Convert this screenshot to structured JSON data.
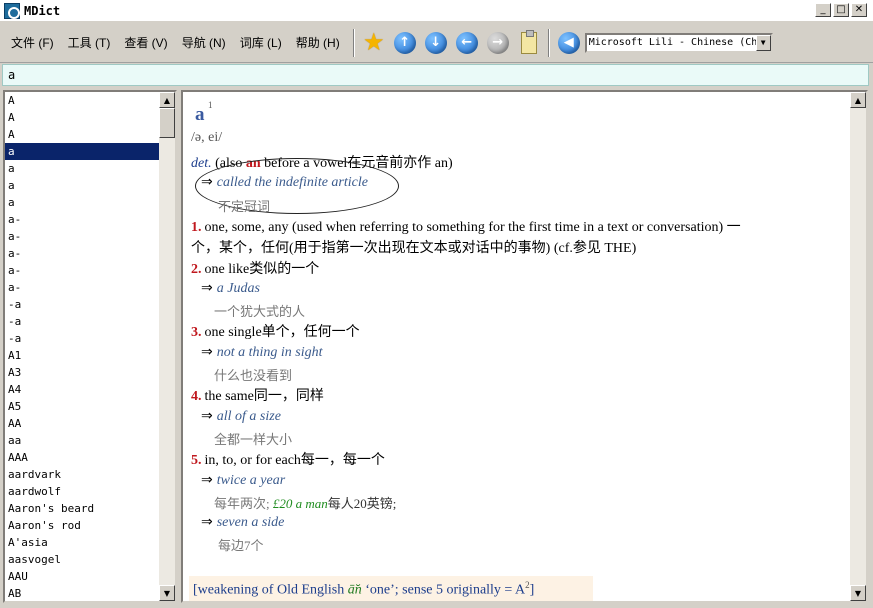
{
  "window": {
    "title": "MDict"
  },
  "menu": [
    "文件 (F)",
    "工具 (T)",
    "查看 (V)",
    "导航 (N)",
    "词库 (L)",
    "帮助 (H)"
  ],
  "toolbar": {
    "icons": [
      "star-icon",
      "up-arrow-icon",
      "down-arrow-icon",
      "back-arrow-icon",
      "forward-arrow-icon",
      "clipboard-icon",
      "speaker-icon"
    ],
    "voice_select": "Microsoft Lili - Chinese (Ch"
  },
  "search": {
    "value": "a"
  },
  "wordlist": {
    "items": [
      "A",
      "A",
      "A",
      "a",
      "a",
      "a",
      "a",
      "a-",
      "a-",
      "a-",
      "a-",
      "a-",
      "-a",
      "-a",
      "-a",
      "A1",
      "A3",
      "A4",
      "A5",
      "AA",
      "aa",
      "AAA",
      "aardvark",
      "aardwolf",
      "Aaron's beard",
      "Aaron's rod",
      "A'asia",
      "aasvogel",
      "AAU",
      "AB"
    ],
    "selected_index": 3
  },
  "entry": {
    "headword": "a",
    "headword_sup": "1",
    "pronunciation": "/ə, ei/",
    "pos": "det.",
    "pos_note_pre": " (also ",
    "pos_note_red": "an",
    "pos_note_post": " before a vowel在元音前亦作 an)",
    "intro_example": "called the indefinite article",
    "intro_translation": "不定冠词",
    "sense1_num": "1.",
    "sense1_line1": "one, some, any (used when referring to something for the first time in a text or conversation) 一",
    "sense1_line2": "个，某个，任何(用于指第一次出现在文本或对话中的事物) (cf.参见 THE)",
    "sense2_num": "2.",
    "sense2_text": "one like类似的一个",
    "sense2_example": "a Judas",
    "sense2_translation": "一个犹大式的人",
    "sense3_num": "3.",
    "sense3_text": "one single单个，任何一个",
    "sense3_example": "not a thing in sight",
    "sense3_translation": "什么也没看到",
    "sense4_num": "4.",
    "sense4_text": "the same同一，同样",
    "sense4_example": "all of a size",
    "sense4_translation": "全都一样大小",
    "sense5_num": "5.",
    "sense5_text": "in, to, or for each每一，每一个",
    "sense5_example1": "twice a year",
    "sense5_translation1_a": "每年两次;",
    "sense5_translation1_green": "£20 a man",
    "sense5_translation1_b": "每人20英镑;",
    "sense5_example2": "seven a side",
    "sense5_translation2": "每边7个",
    "etym_pre": "[weakening of Old English ",
    "etym_em": "ā̆n",
    "etym_post": " ‘one’; sense 5 originally = A",
    "etym_sup": "2",
    "etym_close": "]"
  },
  "arrow_glyph": "⇒"
}
